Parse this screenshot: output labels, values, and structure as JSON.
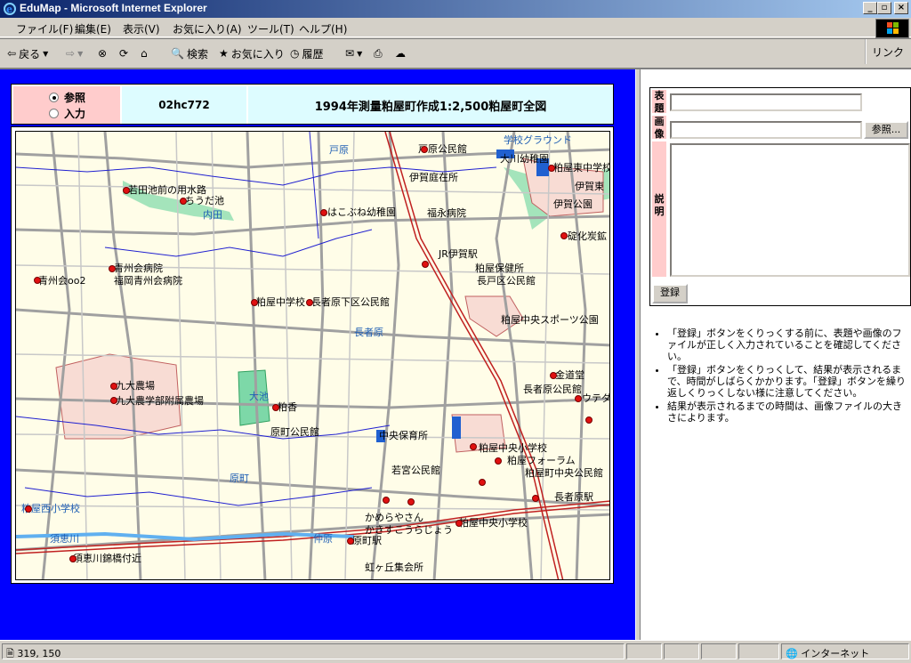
{
  "window": {
    "title": "EduMap - Microsoft Internet Explorer"
  },
  "menu": [
    "ファイル(F)",
    "編集(E)",
    "表示(V)",
    "お気に入り(A)",
    "ツール(T)",
    "ヘルプ(H)"
  ],
  "toolbar": {
    "back": "戻る",
    "search": "検索",
    "favorites": "お気に入り",
    "history": "履歴",
    "links": "リンク"
  },
  "record": {
    "radio_view": "参照",
    "radio_input": "入力",
    "id": "02hc772",
    "title": "1994年測量粕屋町作成1:2,500粕屋町全図"
  },
  "map_labels": [
    "戸原",
    "戸原公民館",
    "大川幼稚園",
    "粕屋東中学校",
    "伊賀公園",
    "伊賀庭在所",
    "碇化炭鉱",
    "若田池前の用水路",
    "ちうだ池",
    "内田",
    "はこぶね幼稚園",
    "福永病院",
    "JR伊賀駅",
    "青州会病院",
    "福岡青州会病院",
    "青州会oo2",
    "粕屋中学校",
    "長者原下区公民館",
    "粕屋保健所",
    "長戸区公民館",
    "粕屋中央スポーツ公園",
    "長者原",
    "九大農場",
    "九大農学部附属農場",
    "大池",
    "粕香",
    "原町公民館",
    "中央保育所",
    "金道堂",
    "長者原公民館",
    "ウテダ",
    "粕屋中央小学校",
    "粕屋フォーラム",
    "若宮公民館",
    "粕屋町中央公民館",
    "長者原駅",
    "原町",
    "粕屋西小学校",
    "須恵川",
    "かめらやさん",
    "かきすこうらじょう",
    "粕屋中央小学校",
    "原町駅",
    "仲原",
    "須恵川錦橋付近",
    "虹ヶ丘集会所",
    "学校グラウンド",
    "伊賀東"
  ],
  "form": {
    "label_title": "表題",
    "label_image": "画像",
    "label_desc": "説明",
    "browse_button": "参照...",
    "submit_button": "登録"
  },
  "notes": [
    "「登録」ボタンをくりっくする前に、表題や画像のファイルが正しく入力されていることを確認してください。",
    "「登録」ボタンをくりっくして、結果が表示されるまで、時間がしばらくかかります。「登録」ボタンを繰り返しくりっくしない様に注意してください。",
    "結果が表示されるまでの時間は、画像ファイルの大きさによります。"
  ],
  "status": {
    "coords": "319, 150",
    "zone": "インターネット"
  }
}
